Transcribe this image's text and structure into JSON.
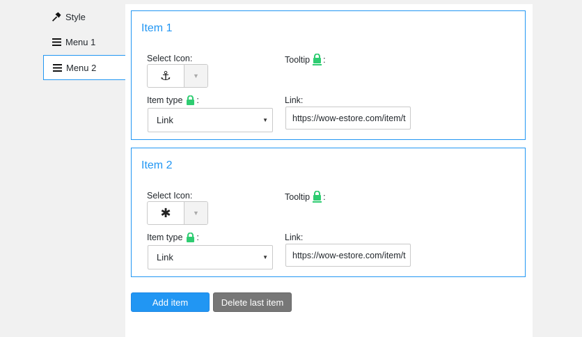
{
  "sidebar": {
    "items": [
      {
        "label": "Style",
        "icon": "hammer-icon"
      },
      {
        "label": "Menu 1",
        "icon": "hamburger-icon"
      },
      {
        "label": "Menu 2",
        "icon": "hamburger-icon",
        "active": true
      }
    ]
  },
  "items": [
    {
      "title": "Item 1",
      "select_icon_label": "Select Icon:",
      "selected_icon": "anchor-icon",
      "selected_icon_glyph": "⚓",
      "tooltip_label": "Tooltip",
      "tooltip_suffix": ":",
      "item_type_label": "Item type",
      "item_type_suffix": ":",
      "item_type_value": "Link",
      "link_label": "Link:",
      "link_value": "https://wow-estore.com/item/t"
    },
    {
      "title": "Item 2",
      "select_icon_label": "Select Icon:",
      "selected_icon": "asterisk-icon",
      "selected_icon_glyph": "✱",
      "tooltip_label": "Tooltip",
      "tooltip_suffix": ":",
      "item_type_label": "Item type",
      "item_type_suffix": ":",
      "item_type_value": "Link",
      "link_label": "Link:",
      "link_value": "https://wow-estore.com/item/t"
    }
  ],
  "actions": {
    "add_label": "Add item",
    "delete_label": "Delete last item"
  },
  "colors": {
    "accent": "#2196f3",
    "lock": "#2ecc71",
    "delete_button": "#777777"
  }
}
